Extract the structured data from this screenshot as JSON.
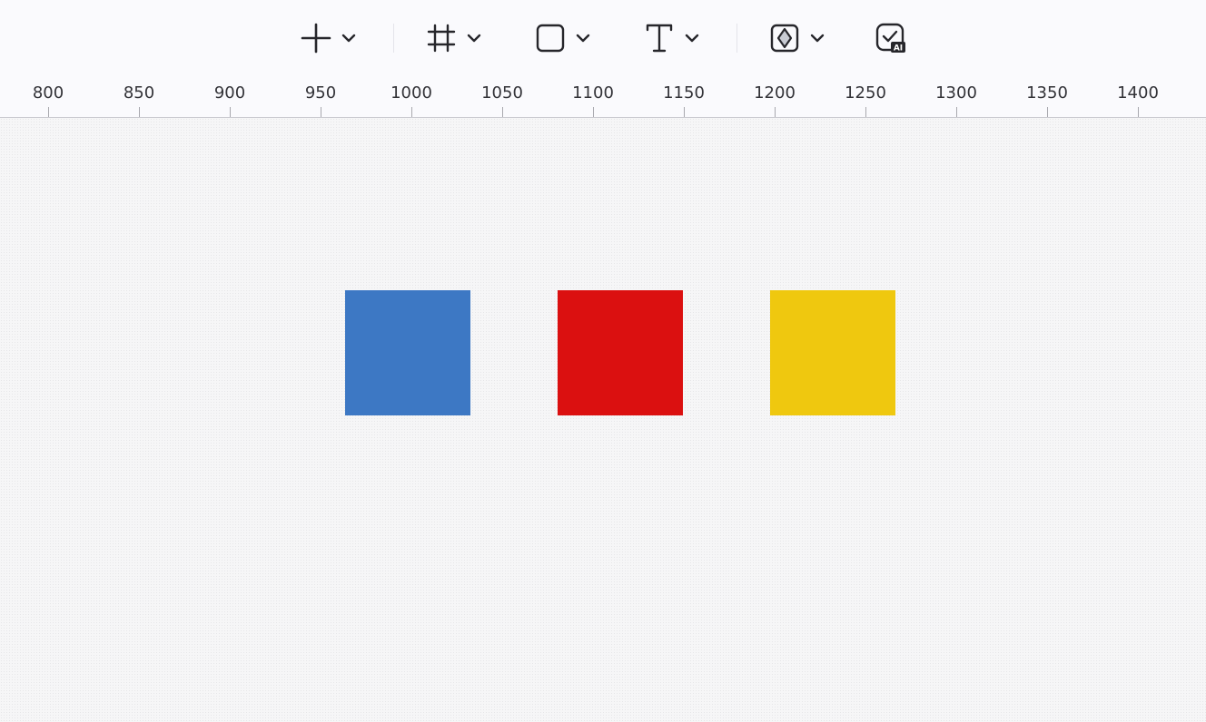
{
  "toolbar": {
    "tools": [
      {
        "name": "add",
        "icon": "plus-icon",
        "has_dropdown": true
      },
      {
        "name": "frame",
        "icon": "frame-icon",
        "has_dropdown": true
      },
      {
        "name": "shape",
        "icon": "rounded-square-icon",
        "has_dropdown": true
      },
      {
        "name": "text",
        "icon": "text-icon",
        "has_dropdown": true
      },
      {
        "name": "component",
        "icon": "diamond-square-icon",
        "has_dropdown": true
      },
      {
        "name": "ai-check",
        "icon": "ai-check-icon",
        "has_dropdown": false,
        "badge": "AI"
      }
    ]
  },
  "ruler": {
    "labels": [
      "800",
      "850",
      "900",
      "950",
      "1000",
      "1050",
      "1100",
      "1150",
      "1200",
      "1250",
      "1300",
      "1350",
      "1400"
    ]
  },
  "canvas": {
    "shapes": [
      {
        "name": "blue-square",
        "color": "#3d78c4"
      },
      {
        "name": "red-square",
        "color": "#db1010"
      },
      {
        "name": "yellow-square",
        "color": "#efc80f"
      }
    ]
  }
}
